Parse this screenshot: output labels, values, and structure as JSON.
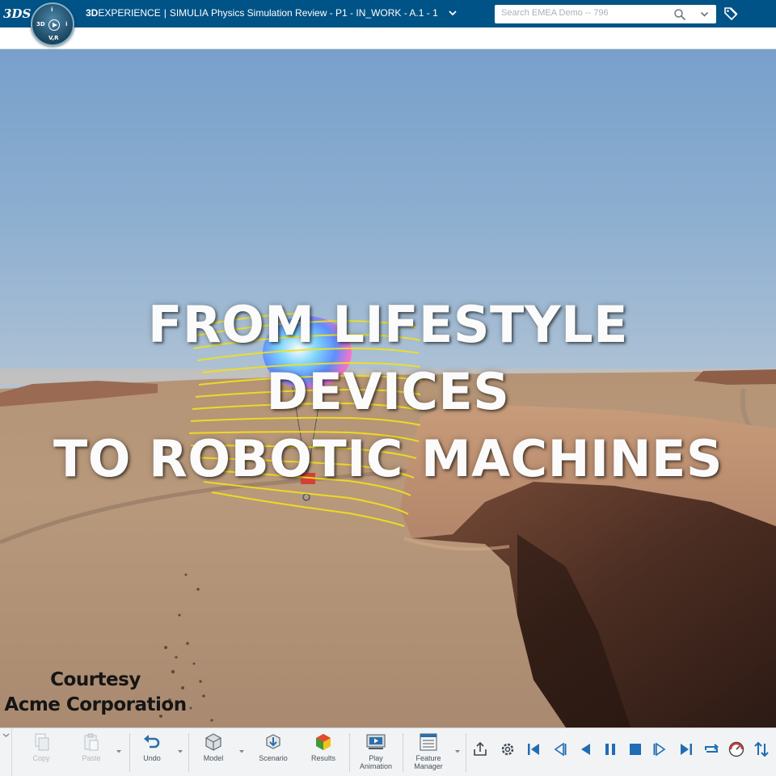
{
  "topbar": {
    "logo_text": "3DS",
    "compass": {
      "north": "i",
      "west": "3D",
      "east": "i",
      "south": "V,R"
    },
    "brand_bold": "3D",
    "brand_text": "EXPERIENCE",
    "brand_sep": "|",
    "brand_app": "SIMULIA",
    "document_title": "Physics Simulation Review - P1 - IN_WORK - A.1 - 1",
    "search_placeholder": "Search EMEA Demo -- 796",
    "icons": [
      "compass-icon",
      "search-icon",
      "chevron-down-icon",
      "tag-icon"
    ]
  },
  "viewport": {
    "overlay_lines": [
      "FROM LIFESTYLE",
      "DEVICES",
      "TO ROBOTIC MACHINES"
    ],
    "courtesy_lines": [
      "Courtesy",
      "Acme Corporation"
    ],
    "colors": {
      "sky_top": "#78a0cb",
      "terrain": "#b89878",
      "streamlines": "#f2e21a"
    }
  },
  "toolbar": {
    "tools": [
      {
        "id": "copy",
        "label": "Copy",
        "icon": "copy-icon",
        "enabled": false
      },
      {
        "id": "paste",
        "label": "Paste",
        "icon": "paste-icon",
        "enabled": false
      },
      {
        "id": "undo",
        "label": "Undo",
        "icon": "undo-icon",
        "enabled": true
      },
      {
        "id": "model",
        "label": "Model",
        "icon": "model-icon",
        "enabled": true
      },
      {
        "id": "scenario",
        "label": "Scenario",
        "icon": "scenario-icon",
        "enabled": true
      },
      {
        "id": "results",
        "label": "Results",
        "icon": "results-icon",
        "enabled": true
      },
      {
        "id": "play_animation",
        "label_line1": "Play",
        "label_line2": "Animation",
        "icon": "play-animation-icon",
        "enabled": true
      },
      {
        "id": "feature_manager",
        "label_line1": "Feature",
        "label_line2": "Manager",
        "icon": "feature-manager-icon",
        "enabled": true
      }
    ],
    "playback_icons": [
      "share-icon",
      "settings-icon",
      "skip-to-start-icon",
      "step-back-icon",
      "play-reverse-icon",
      "pause-icon",
      "stop-icon",
      "step-forward-icon",
      "skip-to-end-icon",
      "loop-icon",
      "speed-gauge-icon",
      "sort-icon"
    ]
  }
}
